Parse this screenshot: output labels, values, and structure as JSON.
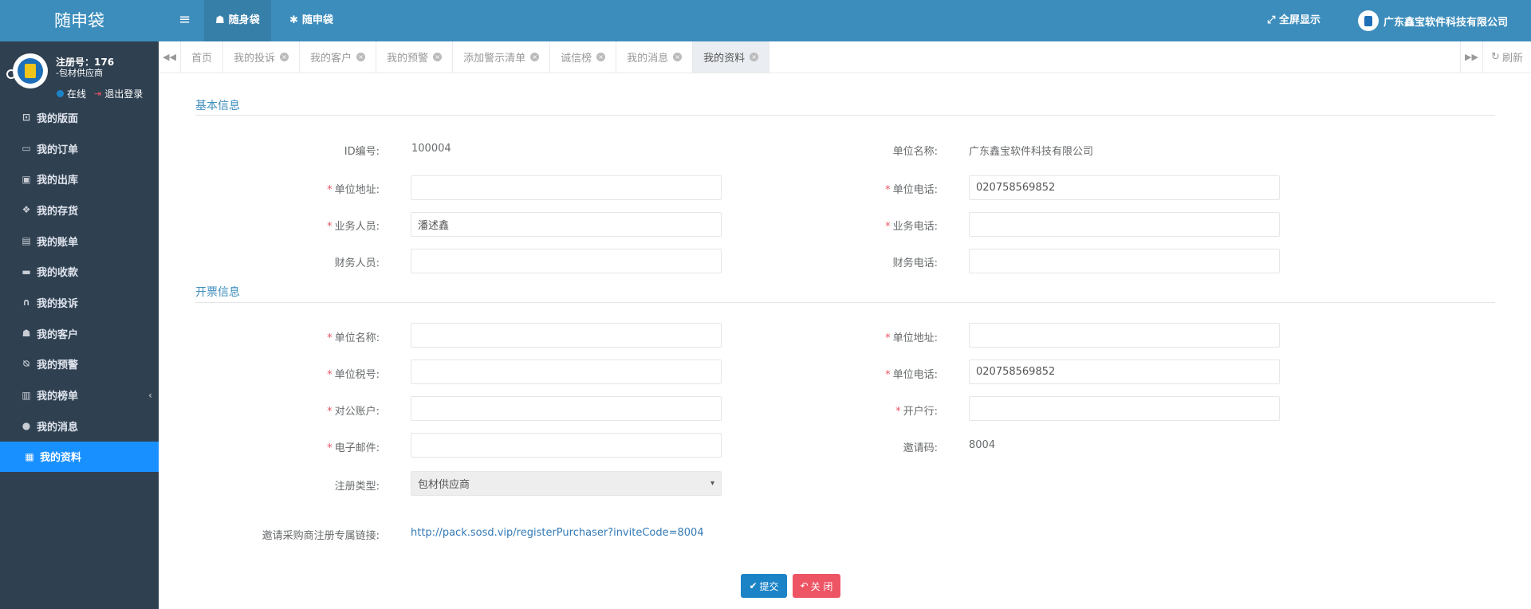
{
  "app": {
    "brand": "随申袋"
  },
  "user": {
    "reg_no": "注册号：176",
    "type": "-包材供应商",
    "status": "在线",
    "logout": "退出登录"
  },
  "sidebar": {
    "items": [
      {
        "label": "我的版面",
        "icon": "monitor-icon"
      },
      {
        "label": "我的订单",
        "icon": "desktop-icon"
      },
      {
        "label": "我的出库",
        "icon": "bus-icon"
      },
      {
        "label": "我的存货",
        "icon": "cubes-icon"
      },
      {
        "label": "我的账单",
        "icon": "ledger-icon"
      },
      {
        "label": "我的收款",
        "icon": "credit-card-icon"
      },
      {
        "label": "我的投诉",
        "icon": "headphones-icon"
      },
      {
        "label": "我的客户",
        "icon": "users-icon"
      },
      {
        "label": "我的预警",
        "icon": "bell-slash-icon"
      },
      {
        "label": "我的榜单",
        "icon": "bar-chart-icon"
      },
      {
        "label": "我的消息",
        "icon": "globe-icon"
      },
      {
        "label": "我的资料",
        "icon": "id-card-icon"
      }
    ]
  },
  "topbar": {
    "tab1": "随身袋",
    "tab2": "随申袋",
    "fullscreen": "全屏显示",
    "company": "广东鑫宝软件科技有限公司"
  },
  "tabs": [
    "首页",
    "我的投诉",
    "我的客户",
    "我的预警",
    "添加警示清单",
    "诚信榜",
    "我的消息",
    "我的资料"
  ],
  "refresh": "刷新",
  "form": {
    "basic_title": "基本信息",
    "invoice_title": "开票信息",
    "id_label": "ID编号:",
    "id_value": "100004",
    "unit_name_label": "单位名称:",
    "unit_name_value": "广东鑫宝软件科技有限公司",
    "unit_addr_label": "单位地址:",
    "unit_addr_value": "",
    "unit_phone_label": "单位电话:",
    "unit_phone_value": "020758569852",
    "salesman_label": "业务人员:",
    "salesman_value": "潘述鑫",
    "sales_phone_label": "业务电话:",
    "sales_phone_value": "",
    "finance_label": "财务人员:",
    "finance_value": "",
    "finance_phone_label": "财务电话:",
    "finance_phone_value": "",
    "inv_name_label": "单位名称:",
    "inv_name_value": "",
    "inv_addr_label": "单位地址:",
    "inv_addr_value": "",
    "inv_tax_label": "单位税号:",
    "inv_tax_value": "",
    "inv_phone_label": "单位电话:",
    "inv_phone_value": "020758569852",
    "inv_account_label": "对公账户:",
    "inv_account_value": "",
    "inv_bank_label": "开户行:",
    "inv_bank_value": "",
    "inv_email_label": "电子邮件:",
    "inv_email_value": "",
    "invite_code_label": "邀请码:",
    "invite_code_value": "8004",
    "reg_type_label": "注册类型:",
    "reg_type_value": "包材供应商",
    "invite_link_label": "邀请采购商注册专属链接:",
    "invite_link_value": "http://pack.sosd.vip/registerPurchaser?inviteCode=8004",
    "submit": "提交",
    "close": "关 闭"
  }
}
